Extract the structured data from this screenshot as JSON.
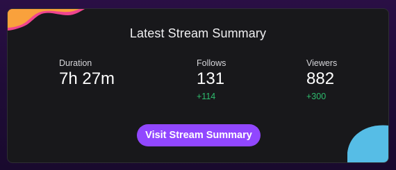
{
  "card": {
    "title": "Latest Stream Summary",
    "stats": {
      "duration": {
        "label": "Duration",
        "value": "7h 27m"
      },
      "follows": {
        "label": "Follows",
        "value": "131",
        "delta": "+114"
      },
      "viewers": {
        "label": "Viewers",
        "value": "882",
        "delta": "+300"
      }
    },
    "cta_label": "Visit Stream Summary"
  },
  "colors": {
    "page_background": "#1f0c37",
    "card_background": "#18181b",
    "accent_purple": "#9147ff",
    "positive_green": "#2ebd6e",
    "blob_orange": "#f9a13c",
    "blob_pink": "#f0458e",
    "blob_blue": "#56bde6"
  }
}
